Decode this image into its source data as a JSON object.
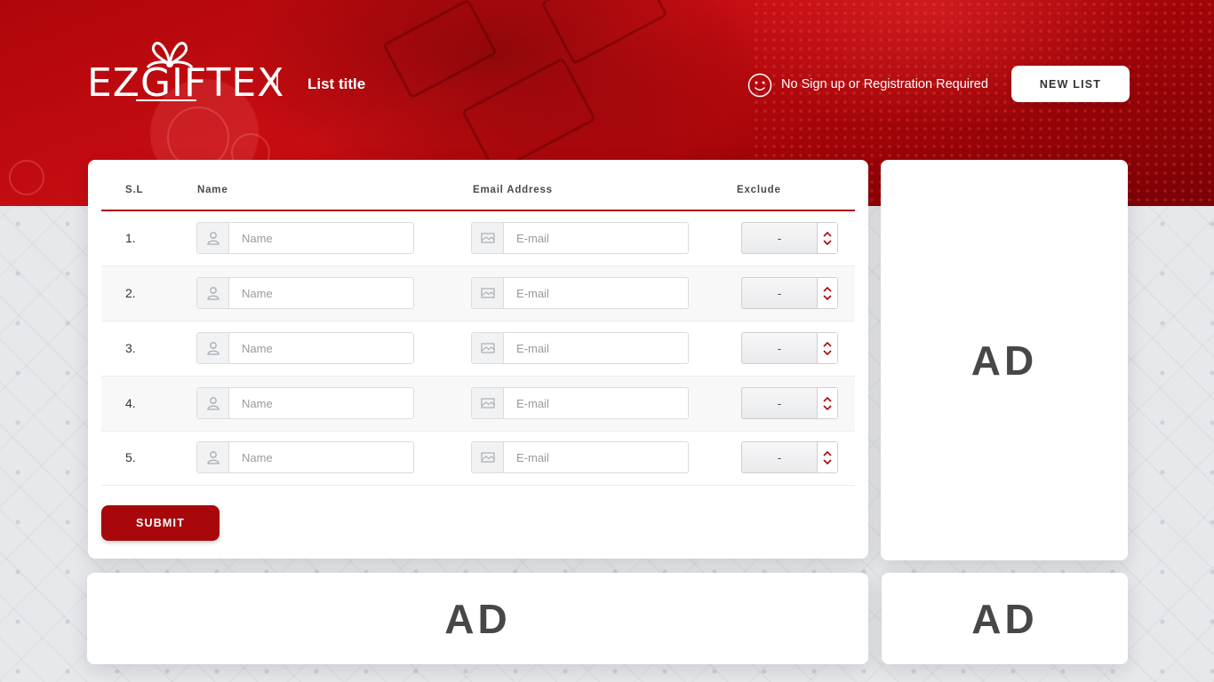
{
  "header": {
    "logo_text": "EZGIFTEX",
    "list_title": "List title",
    "no_signup_text": "No Sign up or Registration Required",
    "new_list_label": "NEW LIST"
  },
  "table": {
    "columns": [
      "S.L",
      "Name",
      "Email Address",
      "Exclude"
    ],
    "rows": [
      {
        "num": "1.",
        "name_placeholder": "Name",
        "email_placeholder": "E-mail",
        "exclude": "-"
      },
      {
        "num": "2.",
        "name_placeholder": "Name",
        "email_placeholder": "E-mail",
        "exclude": "-"
      },
      {
        "num": "3.",
        "name_placeholder": "Name",
        "email_placeholder": "E-mail",
        "exclude": "-"
      },
      {
        "num": "4.",
        "name_placeholder": "Name",
        "email_placeholder": "E-mail",
        "exclude": "-"
      },
      {
        "num": "5.",
        "name_placeholder": "Name",
        "email_placeholder": "E-mail",
        "exclude": "-"
      }
    ]
  },
  "submit_label": "SUBMIT",
  "ads": {
    "right": "AD",
    "bottom": "AD",
    "bottom_small": "AD"
  },
  "icons": [
    "gift-bow-icon",
    "smiley-icon",
    "user-icon",
    "mail-icon",
    "chevron-up-icon",
    "chevron-down-icon"
  ],
  "colors": {
    "brand_red": "#a8070c",
    "header_red": "#c70d12",
    "background": "#e7e9ec"
  }
}
